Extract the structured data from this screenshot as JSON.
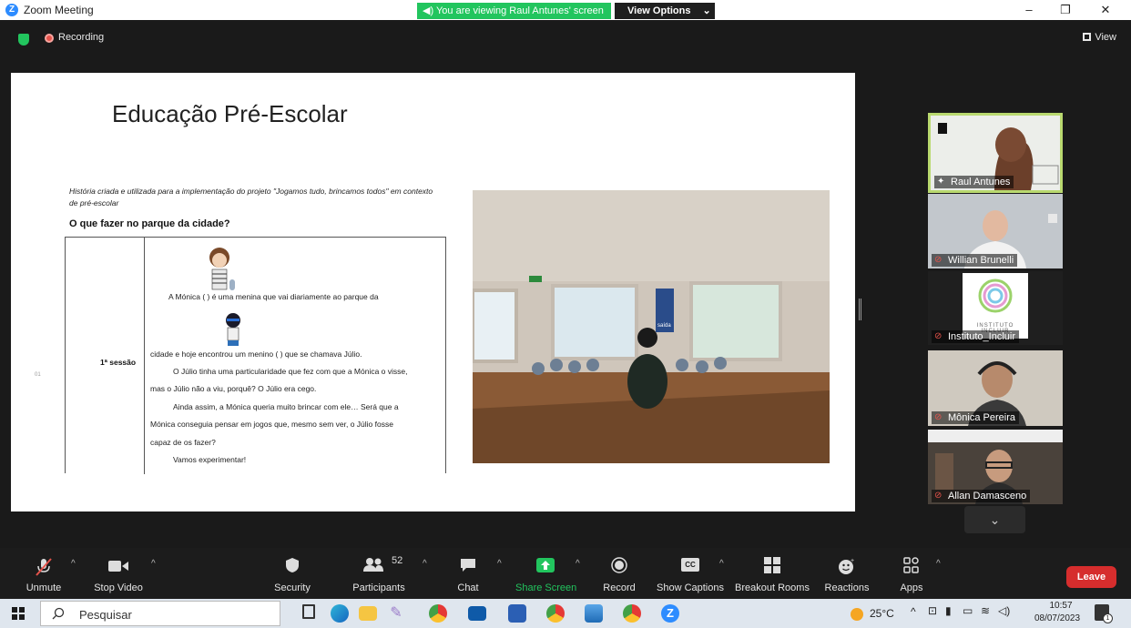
{
  "window": {
    "title": "Zoom Meeting",
    "share_banner": "You are viewing Raul Antunes' screen",
    "view_options": "View Options"
  },
  "meeting": {
    "recording": "Recording",
    "view": "View"
  },
  "slide": {
    "title": "Educação Pré-Escolar",
    "note": "História criada e utilizada para a implementação do projeto \"Jogamos tudo, brincamos todos\" em contexto de pré-escolar",
    "heading": "O que fazer no parque da cidade?",
    "session_label": "1ª sessão",
    "row_marker": "01",
    "story_lines": [
      "A Mónica (                   ) é uma menina que vai diariamente ao parque da",
      "cidade e hoje encontrou um menino (          ) que se chamava Júlio.",
      "O Júlio tinha uma particularidade que fez com que a Mónica o visse,",
      "mas o Júlio não a viu, porquê? O Júlio era cego.",
      "Ainda assim, a Mónica queria muito brincar com ele… Será que a",
      "Mónica conseguia pensar em jogos que, mesmo sem ver, o Júlio fosse",
      "capaz de os fazer?",
      "Vamos experimentar!"
    ],
    "photo_sign": "saída"
  },
  "participants": [
    {
      "name": "Raul Antunes",
      "muted": false
    },
    {
      "name": "Willian Brunelli",
      "muted": true
    },
    {
      "name": "Instituto_Incluir",
      "muted": true,
      "logo_text": "INSTITUTO INCLUIR"
    },
    {
      "name": "Mônica Pereira",
      "muted": true
    },
    {
      "name": "Allan Damasceno",
      "muted": true
    }
  ],
  "toolbar": {
    "unmute": "Unmute",
    "stop_video": "Stop Video",
    "security": "Security",
    "participants": "Participants",
    "participants_count": "52",
    "chat": "Chat",
    "share_screen": "Share Screen",
    "record": "Record",
    "show_captions": "Show Captions",
    "breakout_rooms": "Breakout Rooms",
    "reactions": "Reactions",
    "apps": "Apps",
    "leave": "Leave",
    "cc": "CC"
  },
  "taskbar": {
    "search_placeholder": "Pesquisar",
    "temperature": "25°C",
    "time": "10:57",
    "date": "08/07/2023",
    "notifications": "1"
  },
  "colors": {
    "accent_green": "#22c55e",
    "leave_red": "#d62d2d",
    "active_speaker": "#b9d96f",
    "zoom_blue": "#2d8cff"
  }
}
